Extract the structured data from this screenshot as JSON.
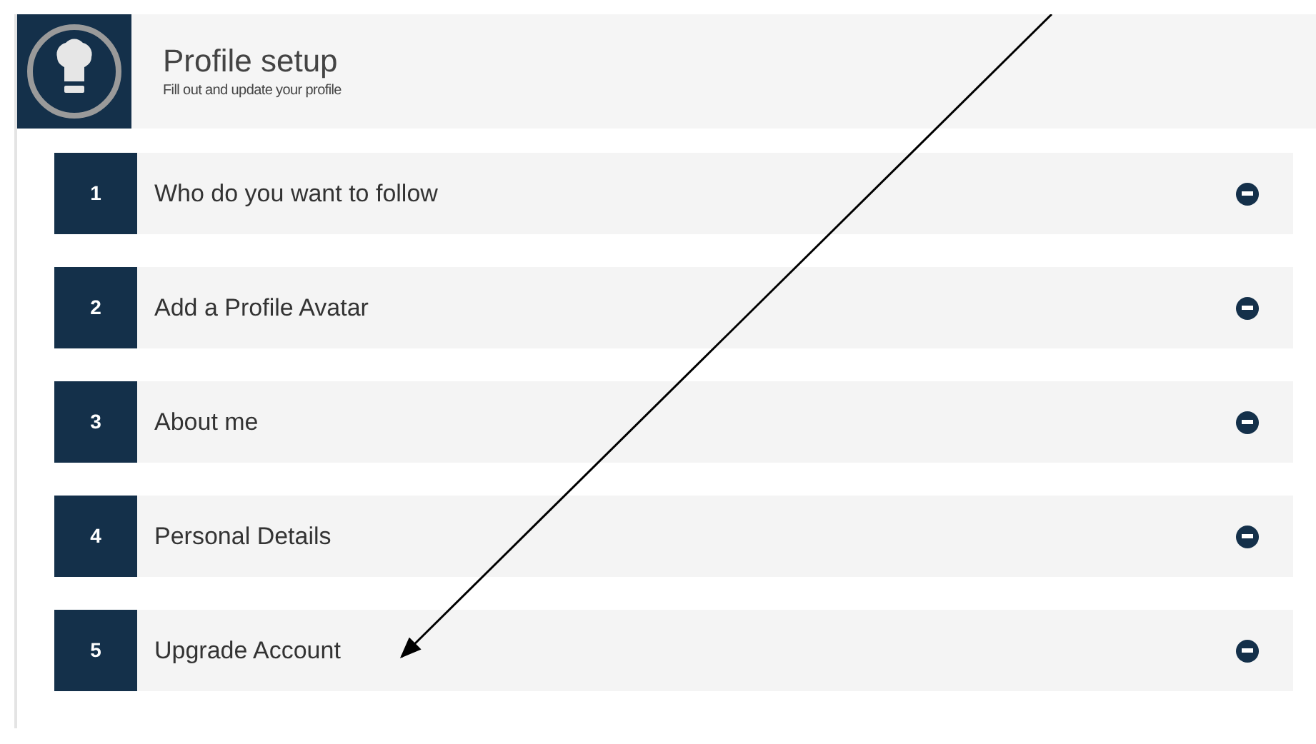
{
  "header": {
    "title": "Profile setup",
    "subtitle": "Fill out and update your profile"
  },
  "steps": [
    {
      "number": "1",
      "label": "Who do you want to follow"
    },
    {
      "number": "2",
      "label": "Add a Profile Avatar"
    },
    {
      "number": "3",
      "label": "About me"
    },
    {
      "number": "4",
      "label": "Personal Details"
    },
    {
      "number": "5",
      "label": "Upgrade Account"
    }
  ]
}
